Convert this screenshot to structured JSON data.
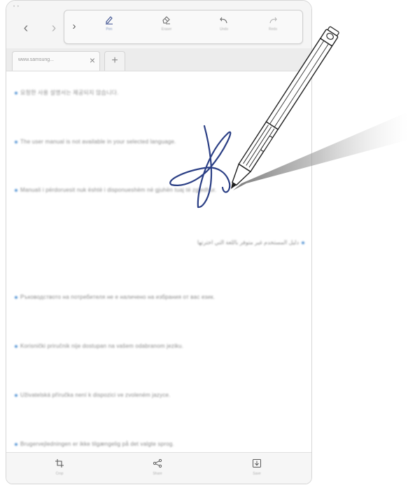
{
  "status_dots": "• •",
  "nav": {
    "back_glyph": "‹",
    "forward_glyph": "›"
  },
  "toolbar": {
    "expand_glyph": "›",
    "tools": [
      {
        "label": "Pen",
        "icon": "pen-icon",
        "active": true
      },
      {
        "label": "Eraser",
        "icon": "eraser-icon",
        "active": false
      },
      {
        "label": "Undo",
        "icon": "undo-icon",
        "active": false
      },
      {
        "label": "Redo",
        "icon": "redo-icon",
        "active": false
      }
    ]
  },
  "tabs": {
    "current_title": "www.samsung...",
    "close_glyph": "×",
    "new_tab_glyph": "+"
  },
  "content": {
    "lines": [
      "요청한 사용 설명서는 제공되지 않습니다.",
      "The user manual is not available in your selected language.",
      "Manuali i përdoruesit nuk është i disponueshëm në gjuhën tuaj të zgjedhur.",
      "دليل المستخدم غير متوفر باللغة التي اخترتها",
      "Ръководството на потребителя не е наличено на избрания от вас език.",
      "Korisnički priručnik nije dostupan na vašem odabranom jeziku.",
      "Uživatelská příručka není k dispozici ve zvoleném jazyce.",
      "Brugervejledningen er ikke tilgængelig på det valgte sprog."
    ]
  },
  "bottom": {
    "buttons": [
      {
        "label": "Crop",
        "icon": "crop-icon"
      },
      {
        "label": "Share",
        "icon": "share-icon"
      },
      {
        "label": "Save",
        "icon": "save-icon"
      }
    ]
  },
  "colors": {
    "ink": "#2b3f85",
    "accent": "#5b98d6"
  }
}
